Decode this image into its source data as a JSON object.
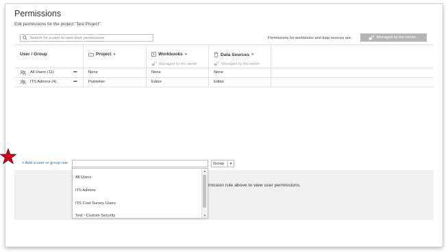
{
  "header": {
    "title": "Permissions",
    "subtitle": "Edit permissions for the project \"Test Project\"."
  },
  "search": {
    "placeholder": "Search for a user to view their permissions"
  },
  "scope": {
    "label": "Permissions for workbooks and data sources are:",
    "button_label": "Managed by the owner..."
  },
  "table": {
    "columns": [
      {
        "label": "User / Group",
        "icon": ""
      },
      {
        "label": "Project",
        "icon": "folder-icon",
        "sub": ""
      },
      {
        "label": "Workbooks",
        "icon": "workbook-icon",
        "sub": "Managed by the owner"
      },
      {
        "label": "Data Sources",
        "icon": "database-icon",
        "sub": "Managed by the owner"
      }
    ],
    "expand_glyph": "»",
    "more_glyph": "•••",
    "rows": [
      {
        "name": "All Users (11)",
        "project": "None",
        "workbooks": "None",
        "datasources": "None"
      },
      {
        "name": "ITS Admins (4)",
        "project": "Publisher",
        "workbooks": "Editor",
        "datasources": "Editor"
      }
    ]
  },
  "add_rule": {
    "link_label": "+ Add a user or group rule",
    "input_value": "",
    "type_selected": "Group",
    "options": [
      "All Users",
      "ITS Admins",
      "ITS Cost Survey Users",
      "Test - Custom Security"
    ]
  },
  "hint_text": "mission rule above to view user permissions.",
  "colors": {
    "accent_link": "#2f6fb0",
    "star": "#d0021b",
    "button_bg": "#b5b5b5"
  }
}
